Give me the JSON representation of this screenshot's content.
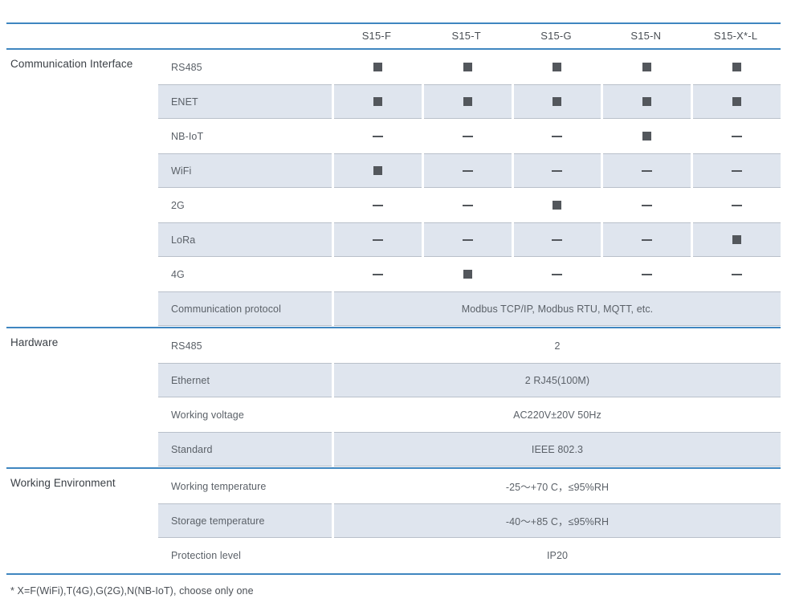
{
  "colors": {
    "rule_blue": "#3f86c0",
    "shade": "#dfe5ee",
    "marker": "#53575c",
    "text": "#4a4f55"
  },
  "header": {
    "columns": [
      "S15-F",
      "S15-T",
      "S15-G",
      "S15-N",
      "S15-X*-L"
    ]
  },
  "sections": [
    {
      "label": "Communication Interface",
      "rows": [
        {
          "label": "RS485",
          "type": "marks",
          "marks": [
            "square",
            "square",
            "square",
            "square",
            "square"
          ]
        },
        {
          "label": "ENET",
          "type": "marks",
          "marks": [
            "square",
            "square",
            "square",
            "square",
            "square"
          ]
        },
        {
          "label": "NB-IoT",
          "type": "marks",
          "marks": [
            "dash",
            "dash",
            "dash",
            "square",
            "dash"
          ]
        },
        {
          "label": "WiFi",
          "type": "marks",
          "marks": [
            "square",
            "dash",
            "dash",
            "dash",
            "dash"
          ]
        },
        {
          "label": "2G",
          "type": "marks",
          "marks": [
            "dash",
            "dash",
            "square",
            "dash",
            "dash"
          ]
        },
        {
          "label": "LoRa",
          "type": "marks",
          "marks": [
            "dash",
            "dash",
            "dash",
            "dash",
            "square"
          ]
        },
        {
          "label": "4G",
          "type": "marks",
          "marks": [
            "dash",
            "square",
            "dash",
            "dash",
            "dash"
          ]
        },
        {
          "label": "Communication protocol",
          "type": "span",
          "value": "Modbus TCP/IP, Modbus RTU, MQTT, etc."
        }
      ]
    },
    {
      "label": "Hardware",
      "rows": [
        {
          "label": "RS485",
          "type": "span",
          "value": "2"
        },
        {
          "label": "Ethernet",
          "type": "span",
          "value": "2 RJ45(100M)"
        },
        {
          "label": "Working voltage",
          "type": "span",
          "value": "AC220V±20V 50Hz"
        },
        {
          "label": "Standard",
          "type": "span",
          "value": "IEEE 802.3"
        }
      ]
    },
    {
      "label": "Working Environment",
      "rows": [
        {
          "label": "Working temperature",
          "type": "span",
          "value": "-25～+70 C，≤95%RH"
        },
        {
          "label": "Storage temperature",
          "type": "span",
          "value": "-40～+85 C，≤95%RH"
        },
        {
          "label": "Protection level",
          "type": "span",
          "value": "IP20"
        }
      ]
    }
  ],
  "footnote": "* X=F(WiFi),T(4G),G(2G),N(NB-IoT), choose only one"
}
